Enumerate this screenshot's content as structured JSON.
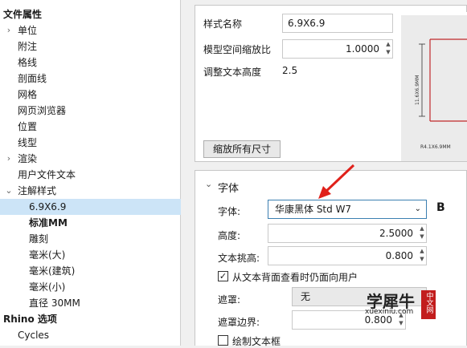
{
  "tree": {
    "items": [
      {
        "label": "文件属性",
        "bold": true,
        "arrow": "",
        "indent": 0
      },
      {
        "label": "单位",
        "bold": false,
        "arrow": "›",
        "indent": 1
      },
      {
        "label": "附注",
        "bold": false,
        "arrow": "",
        "indent": 1
      },
      {
        "label": "格线",
        "bold": false,
        "arrow": "",
        "indent": 1
      },
      {
        "label": "剖面线",
        "bold": false,
        "arrow": "",
        "indent": 1
      },
      {
        "label": "网格",
        "bold": false,
        "arrow": "",
        "indent": 1
      },
      {
        "label": "网页浏览器",
        "bold": false,
        "arrow": "",
        "indent": 1
      },
      {
        "label": "位置",
        "bold": false,
        "arrow": "",
        "indent": 1
      },
      {
        "label": "线型",
        "bold": false,
        "arrow": "",
        "indent": 1
      },
      {
        "label": "渲染",
        "bold": false,
        "arrow": "›",
        "indent": 1
      },
      {
        "label": "用户文件文本",
        "bold": false,
        "arrow": "",
        "indent": 1
      },
      {
        "label": "注解样式",
        "bold": false,
        "arrow": "⌄",
        "indent": 1
      },
      {
        "label": "6.9X6.9",
        "bold": false,
        "arrow": "",
        "indent": 2,
        "selected": true
      },
      {
        "label": "标准MM",
        "bold": true,
        "arrow": "",
        "indent": 2
      },
      {
        "label": "雕刻",
        "bold": false,
        "arrow": "",
        "indent": 2
      },
      {
        "label": "毫米(大)",
        "bold": false,
        "arrow": "",
        "indent": 2
      },
      {
        "label": "毫米(建筑)",
        "bold": false,
        "arrow": "",
        "indent": 2
      },
      {
        "label": "毫米(小)",
        "bold": false,
        "arrow": "",
        "indent": 2
      },
      {
        "label": "直径 30MM",
        "bold": false,
        "arrow": "",
        "indent": 2
      },
      {
        "label": "Rhino 选项",
        "bold": true,
        "arrow": "",
        "indent": 0
      },
      {
        "label": "Cycles",
        "bold": false,
        "arrow": "",
        "indent": 1
      }
    ]
  },
  "style": {
    "name_label": "样式名称",
    "name_value": "6.9X6.9",
    "scale_label": "模型空间缩放比",
    "scale_value": "1.0000",
    "adjust_label": "调整文本高度",
    "adjust_value": "2.5",
    "scale_all_button": "缩放所有尺寸",
    "preview_text_1": "11.6X6.9MM",
    "preview_text_2": "R4.1X6.9MM"
  },
  "font_section": {
    "header": "字体",
    "font_label": "字体:",
    "font_value": "华康黑体 Std W7",
    "bold_label": "B",
    "height_label": "高度:",
    "height_value": "2.5000",
    "raise_label": "文本挑高:",
    "raise_value": "0.800",
    "face_user_label": "从文本背面查看时仍面向用户",
    "face_user_checked": true,
    "mask_label": "遮罩:",
    "mask_value": "无",
    "mask_margin_label": "遮罩边界:",
    "mask_margin_value": "0.800",
    "draw_frame_label": "绘制文本框",
    "draw_frame_checked": false
  },
  "watermark": {
    "text": "学犀牛",
    "url": "xuexiniu.com",
    "badge": "中文网"
  },
  "colors": {
    "selection": "#cce4f7",
    "annotation_arrow": "#e0211b",
    "preview_bg": "#5a5a60",
    "preview_line": "#c0282a"
  }
}
